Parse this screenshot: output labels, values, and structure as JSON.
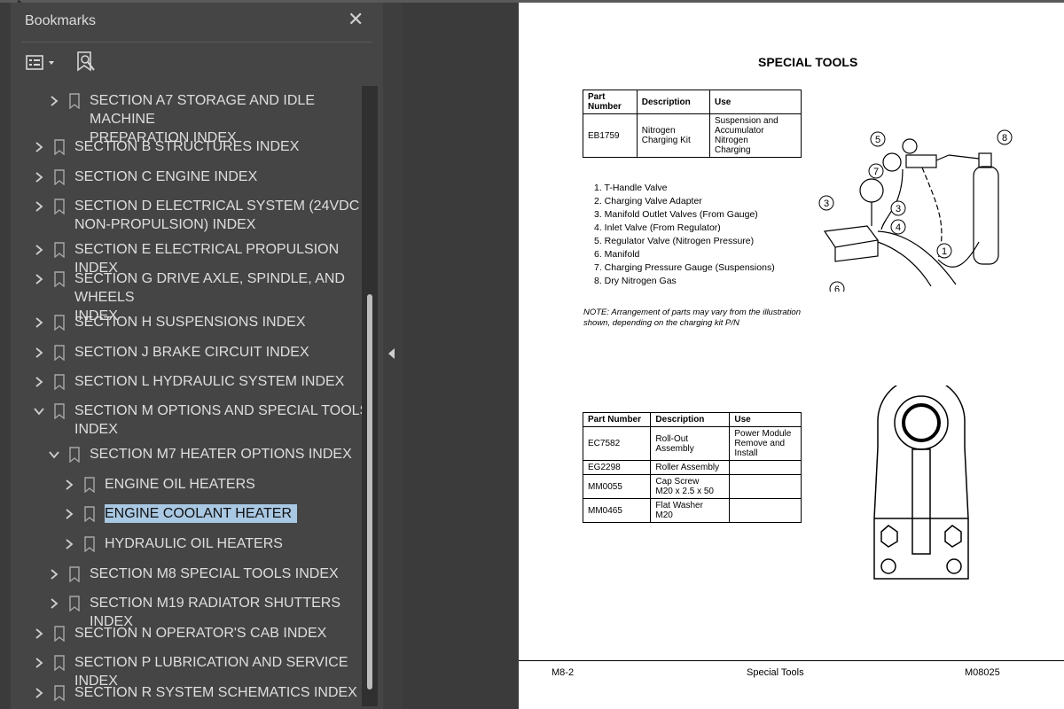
{
  "bookmarks_panel": {
    "title": "Bookmarks",
    "close_icon": "close-icon",
    "options_icon": "list-options-icon",
    "find_icon": "bookmark-find-icon",
    "items": [
      {
        "label": "SECTION A7 STORAGE AND IDLE MACHINE\nPREPARATION INDEX",
        "level": 1,
        "expanded": false,
        "selected": false
      },
      {
        "label": "SECTION B STRUCTURES INDEX",
        "level": 0,
        "expanded": false,
        "selected": false
      },
      {
        "label": "SECTION C ENGINE INDEX",
        "level": 0,
        "expanded": false,
        "selected": false
      },
      {
        "label": "SECTION D ELECTRICAL SYSTEM (24VDC\nNON-PROPULSION) INDEX",
        "level": 0,
        "expanded": false,
        "selected": false
      },
      {
        "label": "SECTION E ELECTRICAL PROPULSION INDEX",
        "level": 0,
        "expanded": false,
        "selected": false
      },
      {
        "label": "SECTION G DRIVE AXLE, SPINDLE, AND WHEELS\nINDEX",
        "level": 0,
        "expanded": false,
        "selected": false
      },
      {
        "label": "SECTION H SUSPENSIONS INDEX",
        "level": 0,
        "expanded": false,
        "selected": false
      },
      {
        "label": "SECTION J BRAKE CIRCUIT INDEX",
        "level": 0,
        "expanded": false,
        "selected": false
      },
      {
        "label": "SECTION L HYDRAULIC SYSTEM INDEX",
        "level": 0,
        "expanded": false,
        "selected": false
      },
      {
        "label": "SECTION M OPTIONS AND SPECIAL TOOLS\nINDEX",
        "level": 0,
        "expanded": true,
        "selected": false
      },
      {
        "label": "SECTION M7 HEATER OPTIONS INDEX",
        "level": 1,
        "expanded": true,
        "selected": false
      },
      {
        "label": "ENGINE OIL HEATERS",
        "level": 2,
        "expanded": false,
        "selected": false
      },
      {
        "label": "ENGINE COOLANT HEATER",
        "level": 2,
        "expanded": false,
        "selected": true
      },
      {
        "label": "HYDRAULIC OIL HEATERS",
        "level": 2,
        "expanded": false,
        "selected": false
      },
      {
        "label": "SECTION M8 SPECIAL TOOLS INDEX",
        "level": 1,
        "expanded": false,
        "selected": false
      },
      {
        "label": "SECTION M19 RADIATOR SHUTTERS INDEX",
        "level": 1,
        "expanded": false,
        "selected": false
      },
      {
        "label": "SECTION N OPERATOR'S CAB INDEX",
        "level": 0,
        "expanded": false,
        "selected": false
      },
      {
        "label": "SECTION P LUBRICATION AND SERVICE INDEX",
        "level": 0,
        "expanded": false,
        "selected": false
      },
      {
        "label": "SECTION R SYSTEM SCHEMATICS INDEX",
        "level": 0,
        "expanded": false,
        "selected": false
      }
    ]
  },
  "document": {
    "title": "SPECIAL TOOLS",
    "table1": {
      "headers": [
        "Part\nNumber",
        "Description",
        "Use"
      ],
      "rows": [
        [
          "EB1759",
          "Nitrogen\nCharging Kit",
          "Suspension and\nAccumulator\nNitrogen\nCharging"
        ]
      ]
    },
    "parts_list": [
      "1. T-Handle Valve",
      "2. Charging Valve Adapter",
      "3. Manifold Outlet Valves (From Gauge)",
      "4. Inlet Valve (From Regulator)",
      "5. Regulator Valve (Nitrogen Pressure)",
      "6. Manifold",
      "7. Charging Pressure Gauge (Suspensions)",
      "8. Dry Nitrogen Gas"
    ],
    "note": "NOTE: Arrangement of parts may vary from the illustration shown, depending on the charging kit P/N",
    "illustration1_callouts": [
      "5",
      "8",
      "7",
      "3",
      "3",
      "4",
      "1",
      "6"
    ],
    "table2": {
      "headers": [
        "Part Number",
        "Description",
        "Use"
      ],
      "rows": [
        [
          "EC7582",
          "Roll-Out\nAssembly",
          "Power Module\nRemove and\nInstall"
        ],
        [
          "EG2298",
          "Roller Assembly",
          ""
        ],
        [
          "MM0055",
          "Cap Screw\nM20 x 2.5 x 50",
          ""
        ],
        [
          "MM0465",
          "Flat Washer\nM20",
          ""
        ]
      ]
    },
    "footer": {
      "left": "M8-2",
      "center": "Special Tools",
      "right": "M08025"
    }
  },
  "colors": {
    "panel_bg": "#454545",
    "selection": "#a9c8e3",
    "canvas_bg": "#3b3b3b"
  }
}
